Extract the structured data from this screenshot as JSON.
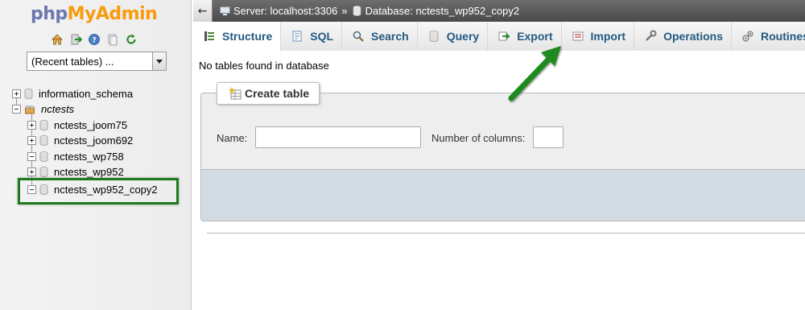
{
  "brand": {
    "part1": "php",
    "part2": "MyAdmin"
  },
  "nav_icons": [
    "home-icon",
    "exit-icon",
    "help-icon",
    "docs-icon",
    "reload-icon"
  ],
  "recent_select": {
    "value": "(Recent tables) ..."
  },
  "tree": {
    "items": [
      {
        "label": "information_schema"
      },
      {
        "label": "nctests"
      },
      {
        "label": "nctests_joom75"
      },
      {
        "label": "nctests_joom692"
      },
      {
        "label": "nctests_wp758"
      },
      {
        "label": "nctests_wp952"
      },
      {
        "label": "nctests_wp952_copy2"
      }
    ]
  },
  "breadcrumb": {
    "back_glyph": "←",
    "server": "Server: localhost:3306",
    "separator": "»",
    "database": "Database: nctests_wp952_copy2"
  },
  "tabs": [
    {
      "label": "Structure",
      "icon": "structure-icon"
    },
    {
      "label": "SQL",
      "icon": "sql-icon"
    },
    {
      "label": "Search",
      "icon": "search-icon"
    },
    {
      "label": "Query",
      "icon": "query-icon"
    },
    {
      "label": "Export",
      "icon": "export-icon"
    },
    {
      "label": "Import",
      "icon": "import-icon"
    },
    {
      "label": "Operations",
      "icon": "operations-icon"
    },
    {
      "label": "Routines",
      "icon": "routines-icon"
    }
  ],
  "notice": "No tables found in database",
  "create_table": {
    "legend": "Create table",
    "name_label": "Name:",
    "name_value": "",
    "columns_label": "Number of columns:",
    "columns_value": ""
  },
  "colors": {
    "highlight": "#1e7a1e",
    "arrow": "#1f8a1f",
    "tab_text": "#235a81",
    "footer": "#d3dce3"
  }
}
